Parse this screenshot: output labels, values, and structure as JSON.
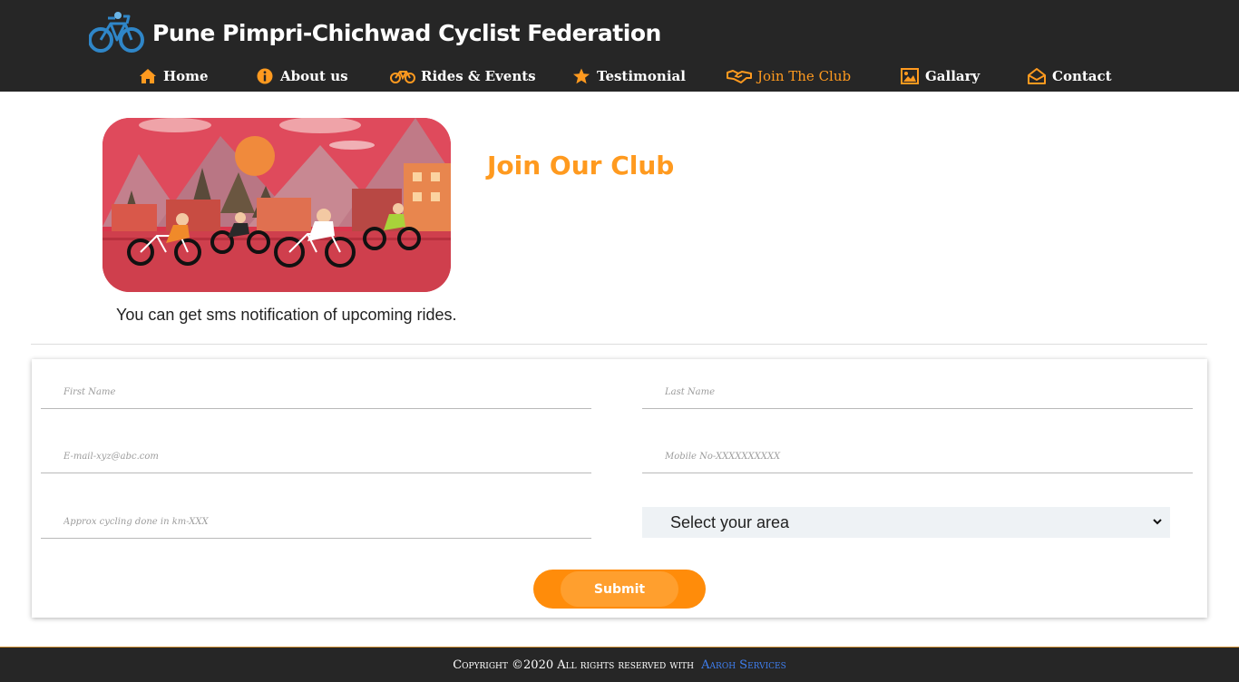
{
  "brand": {
    "title": "Pune Pimpri-Chichwad Cyclist Federation",
    "logo_icon": "bicycle-logo-icon"
  },
  "nav": {
    "items": [
      {
        "label": "Home",
        "icon": "home-icon",
        "active": false
      },
      {
        "label": "About us",
        "icon": "info-circle-icon",
        "active": false
      },
      {
        "label": "Rides & Events",
        "icon": "bicycle-icon",
        "active": false
      },
      {
        "label": "Testimonial",
        "icon": "star-icon",
        "active": false
      },
      {
        "label": "Join The Club",
        "icon": "handshake-icon",
        "active": true
      },
      {
        "label": "Gallary",
        "icon": "image-icon",
        "active": false
      },
      {
        "label": "Contact",
        "icon": "envelope-open-icon",
        "active": false
      }
    ]
  },
  "hero": {
    "title": "Join Our Club",
    "subtitle": "You can get sms notification of upcoming rides.",
    "image": "cyclists-illustration"
  },
  "form": {
    "first_name": {
      "placeholder": "First Name",
      "value": ""
    },
    "last_name": {
      "placeholder": "Last Name",
      "value": ""
    },
    "email": {
      "placeholder": "E-mail-xyz@abc.com",
      "value": ""
    },
    "mobile": {
      "placeholder": "Mobile No-XXXXXXXXXX",
      "value": ""
    },
    "cycling": {
      "placeholder": "Approx cycling done in km-XXX",
      "value": ""
    },
    "area": {
      "selected": "Select your area"
    },
    "submit_label": "Submit"
  },
  "footer": {
    "copyright": "Copyright ©2020 All rights reserved with",
    "link_text": "Aaroh Services"
  },
  "colors": {
    "header_bg": "#262626",
    "accent": "#ff9a1f",
    "button": "#ff8c0a",
    "link": "#3f7ff0",
    "select_bg": "#eef2f5"
  }
}
